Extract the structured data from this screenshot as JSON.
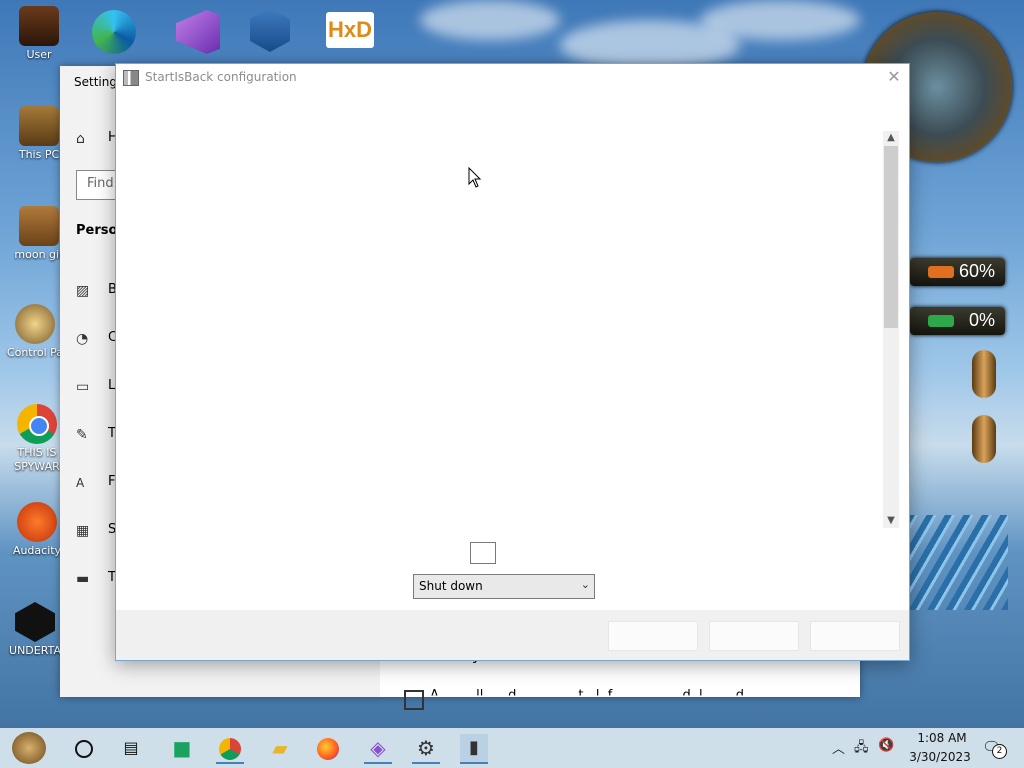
{
  "desktop": {
    "icons": [
      {
        "label": "User"
      },
      {
        "label": "This PC"
      },
      {
        "label": "moon gir"
      },
      {
        "label": "Control Pa"
      },
      {
        "label": "THIS IS SPYWAR"
      },
      {
        "label": "Audacity"
      },
      {
        "label": "UNDERTA"
      }
    ],
    "top_icons": [
      "edge-icon",
      "visual-studio-icon",
      "virtualbox-icon",
      "hxd-icon"
    ],
    "gauges": [
      {
        "value": "60%",
        "color": "#e07020"
      },
      {
        "value": "0%",
        "color": "#2ea84a"
      }
    ]
  },
  "settings": {
    "title": "Settings",
    "home_label": "H",
    "find_placeholder": "Find",
    "section": "Person",
    "items": [
      {
        "icon": "image-icon",
        "label": "B"
      },
      {
        "icon": "palette-icon",
        "label": "C"
      },
      {
        "icon": "lock-screen-icon",
        "label": "Lo"
      },
      {
        "icon": "themes-icon",
        "label": "T"
      },
      {
        "icon": "fonts-icon",
        "label": "F"
      },
      {
        "icon": "start-icon",
        "label": "S"
      },
      {
        "icon": "taskbar-icon",
        "label": "T"
      }
    ],
    "heading_frag": "y",
    "checkbox_text": "A         ll      d               t   l  f                 d  l        d"
  },
  "dialog": {
    "title": "StartIsBack configuration",
    "dropdown_value": "Shut down",
    "footer_buttons": [
      "",
      "",
      ""
    ]
  },
  "taskbar": {
    "time": "1:08 AM",
    "date": "3/30/2023",
    "notification_count": "2"
  }
}
